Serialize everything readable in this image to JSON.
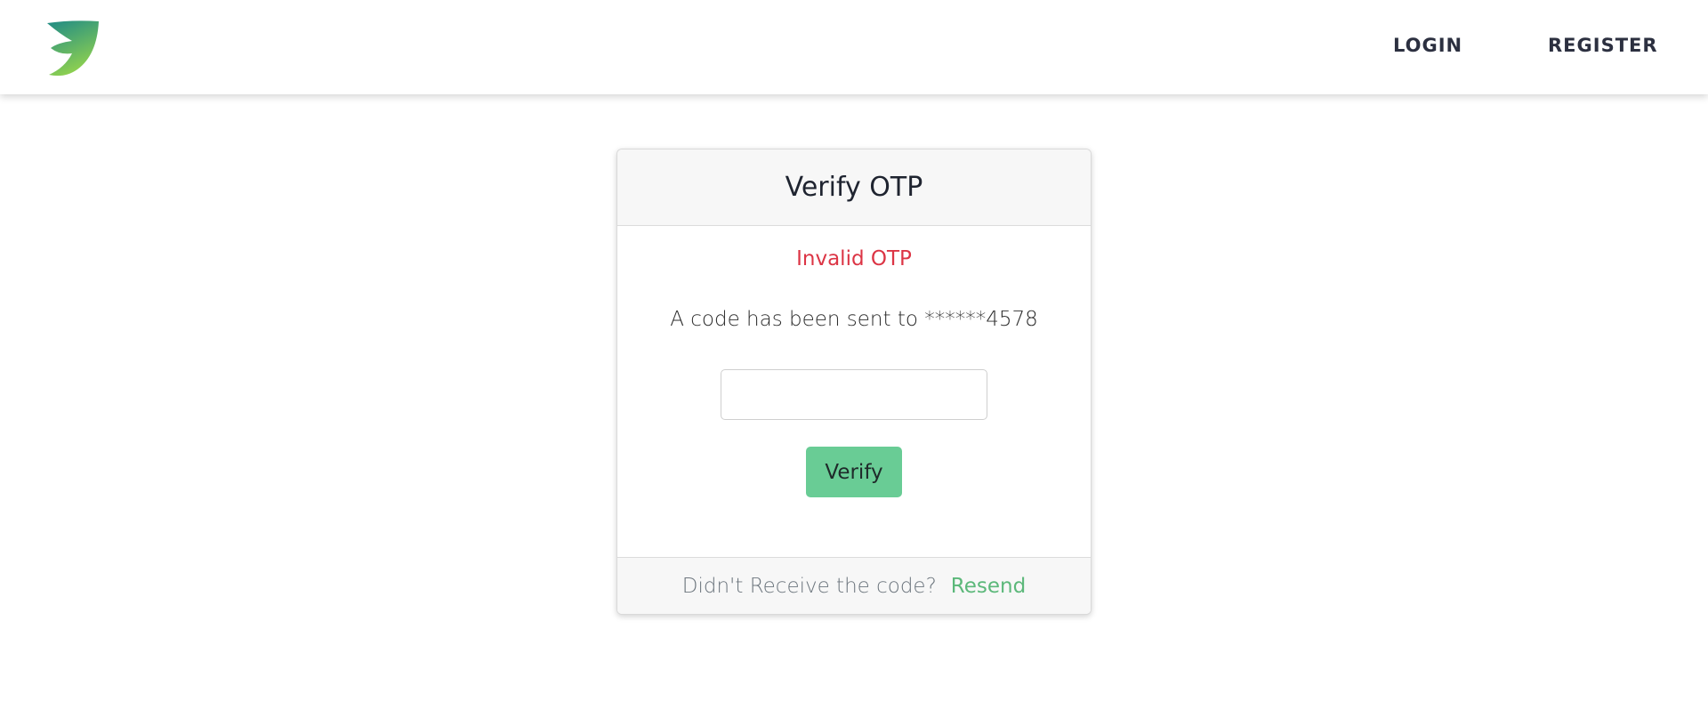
{
  "nav": {
    "login_label": "LOGIN",
    "register_label": "REGISTER"
  },
  "logo": {
    "icon": "leaf-logo-icon",
    "gradient_start": "#1e8a86",
    "gradient_end": "#8fd14f"
  },
  "card": {
    "title": "Verify OTP",
    "error_message": "Invalid OTP",
    "info_message": "A code has been sent to ******4578",
    "otp_input": {
      "value": "",
      "placeholder": ""
    },
    "verify_label": "Verify",
    "footer_text": "Didn't Receive the code?",
    "resend_label": "Resend"
  },
  "colors": {
    "error": "#dc3545",
    "button": "#69cc95",
    "link": "#5cb87a"
  }
}
